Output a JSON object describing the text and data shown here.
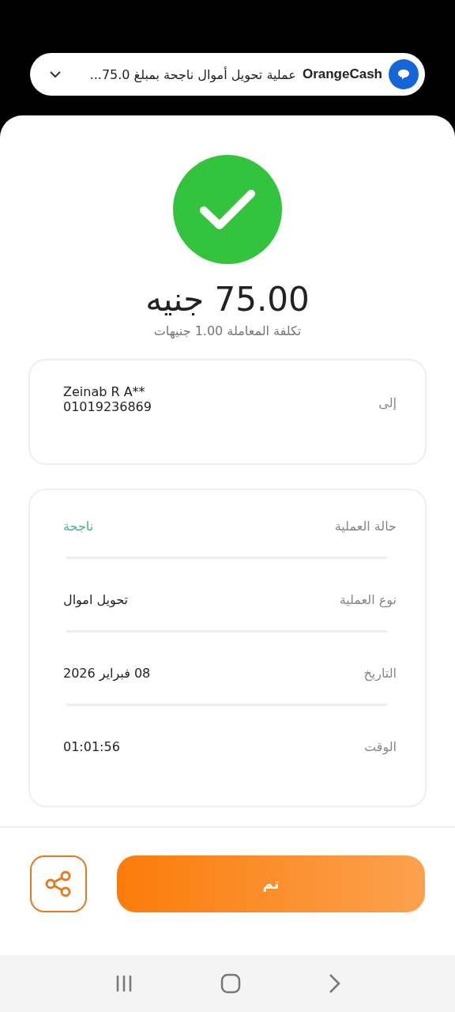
{
  "notification": {
    "app": "OrangeCash",
    "text": "عملية تحويل أموال ناجحة بمبلغ 75.0..."
  },
  "amount": "75.00 جنيه",
  "fee": "تكلفة المعاملة 1.00 جنيهات",
  "recipient": {
    "label": "إلى",
    "name": "Zeinab R A**",
    "phone": "01019236869"
  },
  "details": [
    {
      "label": "حالة العملية",
      "value": "ناجحة",
      "color": "#4cb487"
    },
    {
      "label": "نوع العملية",
      "value": "تحويل اموال"
    },
    {
      "label": "التاريخ",
      "value": "08 فبراير 2026"
    },
    {
      "label": "الوقت",
      "value": "01:01:56"
    }
  ],
  "done_button": "تم"
}
